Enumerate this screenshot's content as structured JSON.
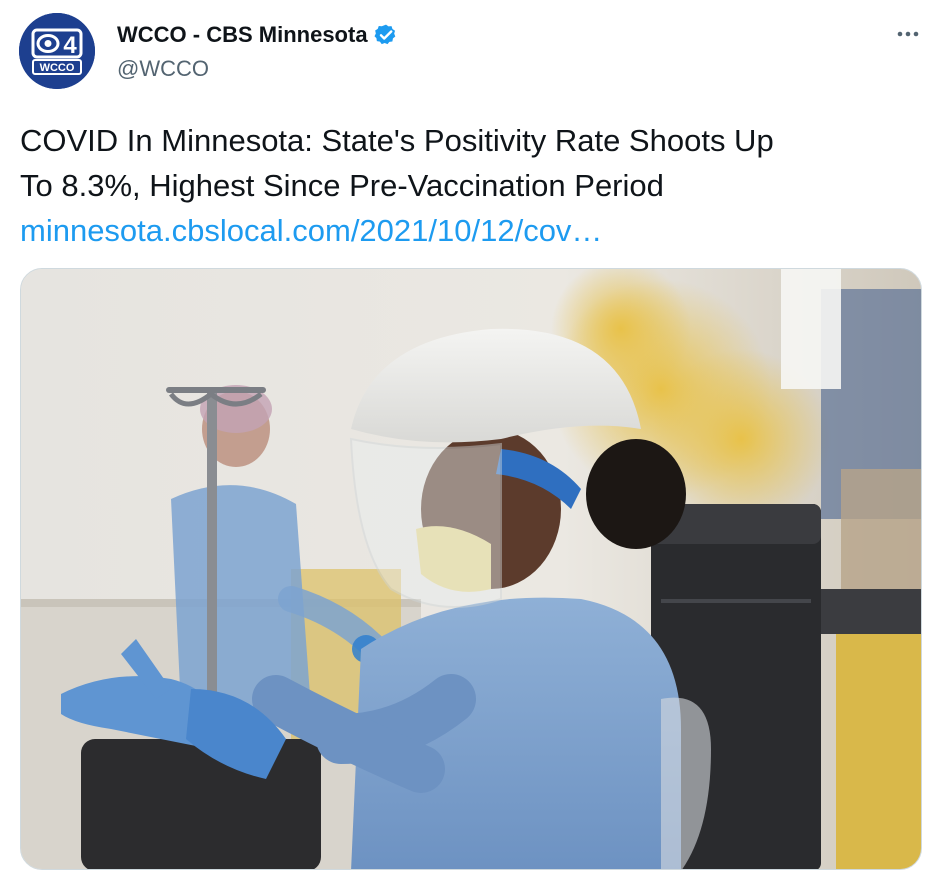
{
  "tweet": {
    "author": {
      "display_name": "WCCO - CBS Minnesota",
      "handle": "@WCCO",
      "verified": true,
      "avatar": {
        "logo_number": "4",
        "logo_text": "WCCO",
        "background_color": "#1d3f8f"
      }
    },
    "more_icon": "more-horizontal-icon",
    "text_lines": [
      "COVID In Minnesota: State's Positivity Rate Shoots Up",
      "To 8.3%, Highest Since Pre-Vaccination Period"
    ],
    "link": "minnesota.cbslocal.com/2021/10/12/cov…",
    "media": {
      "type": "photo"
    }
  },
  "colors": {
    "text": "#0f1419",
    "secondary_text": "#536471",
    "link": "#1d9bf0",
    "verified_badge": "#1d9bf0"
  }
}
